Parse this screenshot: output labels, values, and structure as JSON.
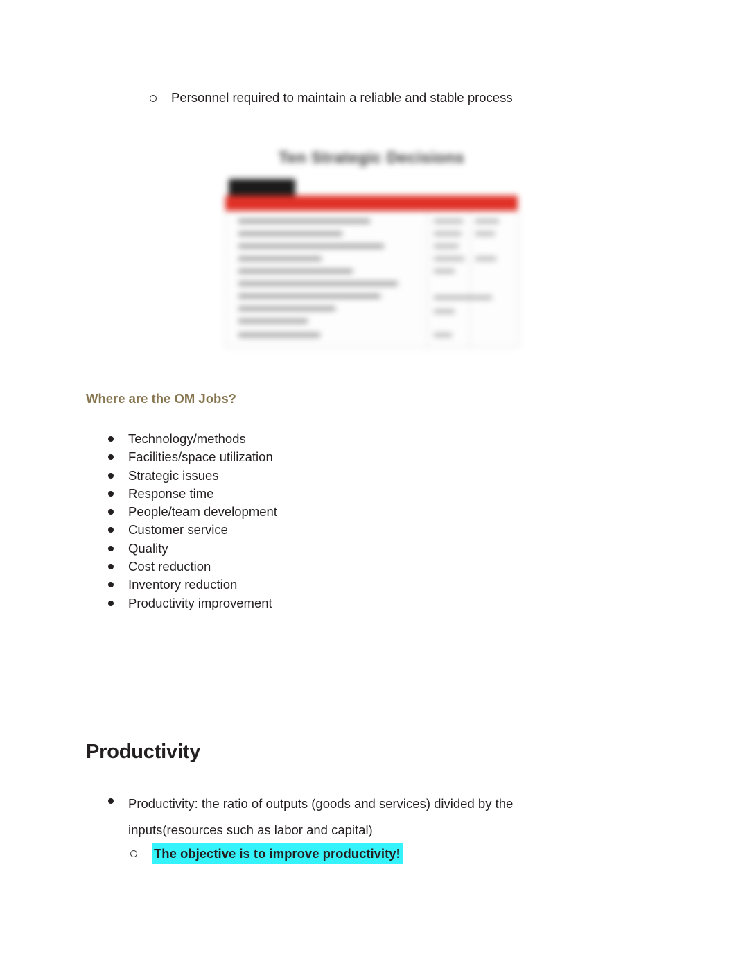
{
  "document": {
    "top_sub_bullet": {
      "bullet_icon": "hollow-circle-bullet-icon",
      "text": "Personnel required to maintain a reliable and stable process"
    },
    "slide_image": {
      "name": "ten-strategic-decisions-slide",
      "title": "Ten Strategic Decisions",
      "blurred": true
    },
    "om_jobs_section": {
      "heading": "Where are the OM Jobs?",
      "items": [
        "Technology/methods",
        "Facilities/space utilization",
        "Strategic issues",
        "Response time",
        "People/team development",
        "Customer service",
        "Quality",
        "Cost reduction",
        "Inventory reduction",
        "Productivity improvement"
      ]
    },
    "productivity_section": {
      "heading": "Productivity",
      "definition": "Productivity: the ratio of outputs (goods and services) divided by the inputs(resources such as labor and capital)",
      "highlighted_note": "The objective is to improve productivity!",
      "highlight_color": "#35f3fb",
      "heading_color": "#231f20",
      "om_heading_color": "#86754f"
    }
  }
}
